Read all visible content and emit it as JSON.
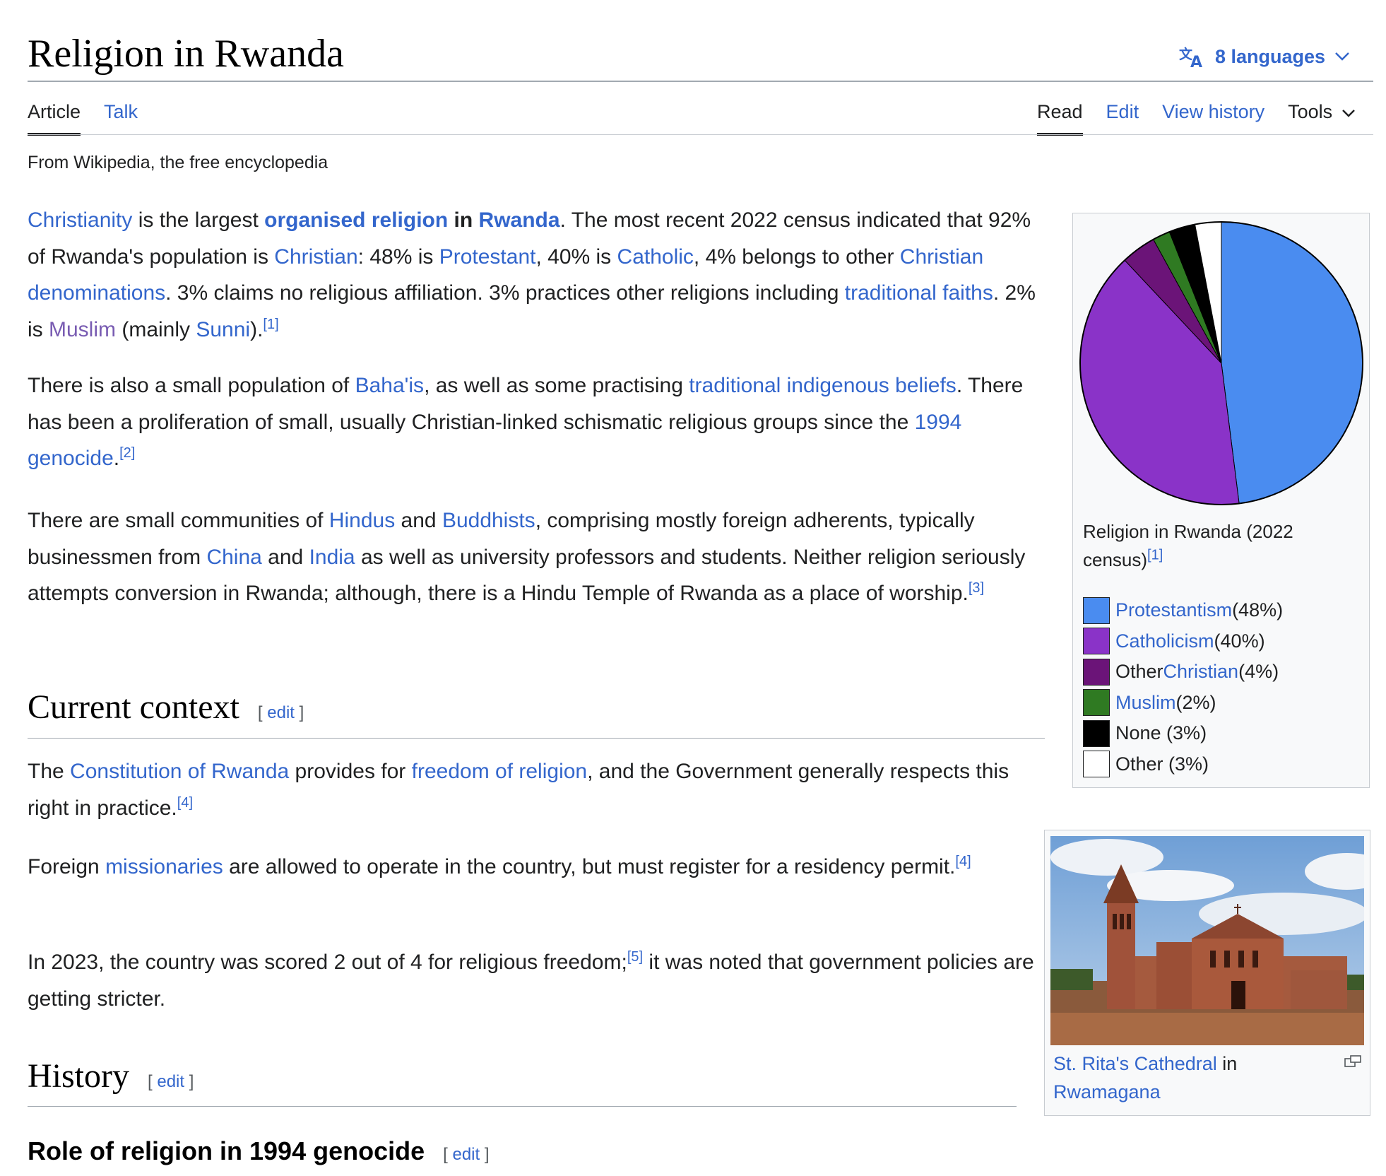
{
  "page": {
    "title": "Religion in Rwanda",
    "languages_label": "8 languages",
    "tagline": "From Wikipedia, the free encyclopedia"
  },
  "tabs": {
    "article": "Article",
    "talk": "Talk",
    "read": "Read",
    "edit": "Edit",
    "view_history": "View history",
    "tools": "Tools"
  },
  "icons": {
    "language": "translate-icon",
    "tools_dropdown": "chevron-down-icon",
    "languages_dropdown": "chevron-down-icon",
    "magnify": "enlarge-icon"
  },
  "intro": {
    "p1": {
      "christianity": "Christianity",
      "t1": " is the largest ",
      "organised_religion": "organised religion",
      "t2": " in ",
      "rwanda": "Rwanda",
      "t3": ". The most recent 2022 census indicated that 92% of Rwanda's population is ",
      "christian": "Christian",
      "t4": ": 48% is ",
      "protestant": "Protestant",
      "t5": ", 40% is ",
      "catholic": "Catholic",
      "t6": ", 4% belongs to other ",
      "denominations": "Christian denominations",
      "t7": ". 3% claims no religious affiliation. 3% practices other religions including ",
      "traditional_faiths": "traditional faiths",
      "t8": ". 2% is ",
      "muslim": "Muslim",
      "t9": " (mainly ",
      "sunni": "Sunni",
      "t10": ").",
      "ref": "[1]"
    },
    "p2": {
      "t1": "There is also a small population of ",
      "bahais": "Baha'is",
      "t2": ", as well as some practising ",
      "indigenous": "traditional indigenous beliefs",
      "t3": ". There has been a proliferation of small, usually Christian-linked schismatic religious groups since the ",
      "genocide": "1994 genocide",
      "t4": ".",
      "ref": "[2]"
    },
    "p3": {
      "t1": "There are small communities of ",
      "hindus": "Hindus",
      "t2": " and ",
      "buddhists": "Buddhists",
      "t3": ", comprising mostly foreign adherents, typically businessmen from ",
      "china": "China",
      "t4": " and ",
      "india": "India",
      "t5": " as well as university professors and students. Neither religion seriously attempts conversion in Rwanda; although, there is a Hindu Temple of Rwanda as a place of worship.",
      "ref": "[3]"
    }
  },
  "sections": {
    "current": {
      "heading": "Current context",
      "edit_open": "[ ",
      "edit": "edit",
      "edit_close": " ]",
      "p1": {
        "t1": "The ",
        "constitution": "Constitution of Rwanda",
        "t2": " provides for ",
        "freedom": "freedom of religion",
        "t3": ", and the Government generally respects this right in practice.",
        "ref": "[4]"
      },
      "p2": {
        "t1": "Foreign ",
        "missionaries": "missionaries",
        "t2": " are allowed to operate in the country, but must register for a residency permit.",
        "ref": "[4]"
      },
      "p3": {
        "t1": "In 2023, the country was scored 2 out of 4 for religious freedom;",
        "ref": "[5]",
        "t2": " it was noted that government policies are getting stricter."
      }
    },
    "history": {
      "heading": "History",
      "edit": "edit"
    },
    "role": {
      "heading": "Role of religion in 1994 genocide",
      "edit": "edit"
    }
  },
  "infobox": {
    "caption": "Religion in Rwanda (2022 census)",
    "caption_ref": "[1]",
    "legend": [
      {
        "pre": "",
        "link": "Protestantism",
        "post": " (48%)",
        "color": "#4a8cf0"
      },
      {
        "pre": "",
        "link": "Catholicism",
        "post": " (40%)",
        "color": "#8a33c8"
      },
      {
        "pre": "Other ",
        "link": "Christian",
        "post": " (4%)",
        "color": "#6b1478"
      },
      {
        "pre": "",
        "link": "Muslim",
        "post": " (2%)",
        "color": "#2f7a22"
      },
      {
        "pre": "None (3%)",
        "link": "",
        "post": "",
        "color": "#000000"
      },
      {
        "pre": "Other (3%)",
        "link": "",
        "post": "",
        "color": "#ffffff"
      }
    ]
  },
  "chart_data": {
    "type": "pie",
    "title": "Religion in Rwanda (2022 census)",
    "categories": [
      "Protestantism",
      "Catholicism",
      "Other Christian",
      "Muslim",
      "None",
      "Other"
    ],
    "values": [
      48,
      40,
      4,
      2,
      3,
      3
    ],
    "colors": [
      "#4a8cf0",
      "#8a33c8",
      "#6b1478",
      "#2f7a22",
      "#000000",
      "#ffffff"
    ],
    "start": "12 o'clock",
    "direction": "clockwise",
    "legend_placement": "below"
  },
  "thumbnail": {
    "link1": "St. Rita's Cathedral",
    "t1": " in",
    "link2": "Rwamagana"
  }
}
